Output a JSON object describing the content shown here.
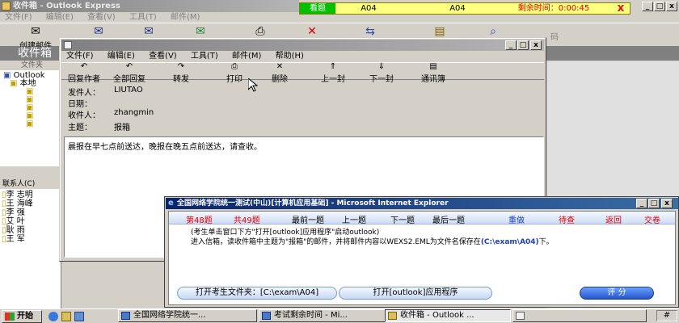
{
  "main_window": {
    "title": "收件箱 - Outlook Express",
    "menu": [
      "文件(F)",
      "编辑(E)",
      "查看(V)",
      "工具(T)",
      "邮件(M)"
    ],
    "toolbar_create": "创建邮件",
    "toolbar_right_label": "码",
    "folder_title": "收件箱",
    "folders_header": "文件夹",
    "tree": [
      "Outlook",
      "本地"
    ],
    "contacts_header": "联系人(C)",
    "contacts": [
      "李 志明",
      "王 海峰",
      "李 强",
      "艾 叶",
      "耿 雨",
      "王 军"
    ]
  },
  "exam_bar": {
    "status": "看题",
    "code1": "A04",
    "code2": "A04",
    "timer_label": "剩余时间：0:00:45",
    "close": "X"
  },
  "message_window": {
    "menu": [
      "文件(F)",
      "编辑(E)",
      "查看(V)",
      "工具(T)",
      "邮件(M)",
      "帮助(H)"
    ],
    "toolbar": [
      "回复作者",
      "全部回复",
      "转发",
      "打印",
      "删除",
      "上一封",
      "下一封",
      "通讯簿"
    ],
    "from_label": "发件人：",
    "from": "LIUTAO",
    "date_label": "日期：",
    "to_label": "收件人：",
    "to": "zhangmin",
    "subject_label": "主题：",
    "subject": "报箱",
    "body": "晨报在早七点前送达，晚报在晚五点前送达，请查收。"
  },
  "exam_window": {
    "title": "全国网络学院统一测试(中山)[计算机应用基础] - Microsoft Internet Explorer",
    "question_num": "第48题",
    "question_total": "共49题",
    "nav": [
      "最前一题",
      "上一题",
      "下一题",
      "最后一题"
    ],
    "redo": "重做",
    "pending": "待查",
    "back": "返回",
    "submit": "交卷",
    "instruction_line1": "(考生单击窗口下方\"打开[outlook]应用程序\"启动outlook)",
    "instruction_line2": "进入信箱，读收件箱中主题为\"报箱\"的邮件，并将邮件内容以WEXS2.EML为文件名保存在",
    "path": "(C:\\exam\\A04)",
    "instruction_end": "下。",
    "btn_open_folder": "打开考生文件夹：[C:\\exam\\A04]",
    "btn_open_outlook": "打开[outlook]应用程序",
    "btn_score": "评 分"
  },
  "taskbar": {
    "start": "开始",
    "tasks": [
      "全国网络学院统一...",
      "考试剩余时间 - Mi...",
      "收件箱 - Outlook ...",
      ""
    ],
    "tray": "#"
  },
  "colors": {
    "title_blue": "#0a246a",
    "exam_yellow": "#ffff80",
    "exam_green": "#00c000",
    "red_text": "#e00000"
  }
}
